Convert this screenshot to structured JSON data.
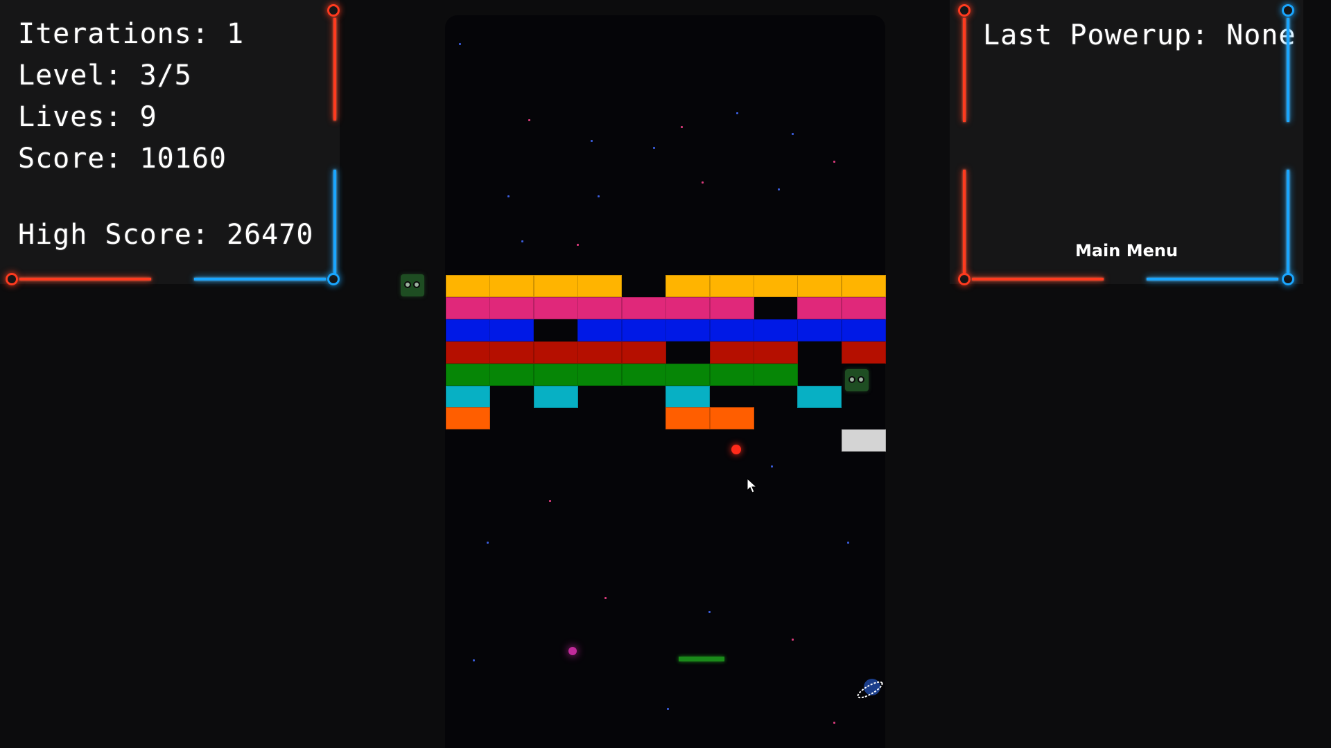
{
  "hud": {
    "iterations": "Iterations: 1",
    "level": "Level: 3/5",
    "lives": "Lives: 9",
    "score": "Score: 10160",
    "high_score": "High Score: 26470",
    "last_powerup": "Last Powerup: None",
    "main_menu": "Main Menu"
  },
  "colors": {
    "yellow": "#ffb400",
    "pink": "#e0287a",
    "blue": "#0019e6",
    "red": "#b50f00",
    "green": "#068606",
    "cyan": "#07b0c4",
    "orange": "#ff5e00",
    "white": "#d4d4d4",
    "frame_red": "#ff3b1f",
    "frame_blue": "#1aa6ff"
  },
  "icons": [
    "enemy-creature-icon",
    "ball-icon",
    "paddle-icon",
    "planet-icon",
    "cursor-icon"
  ]
}
